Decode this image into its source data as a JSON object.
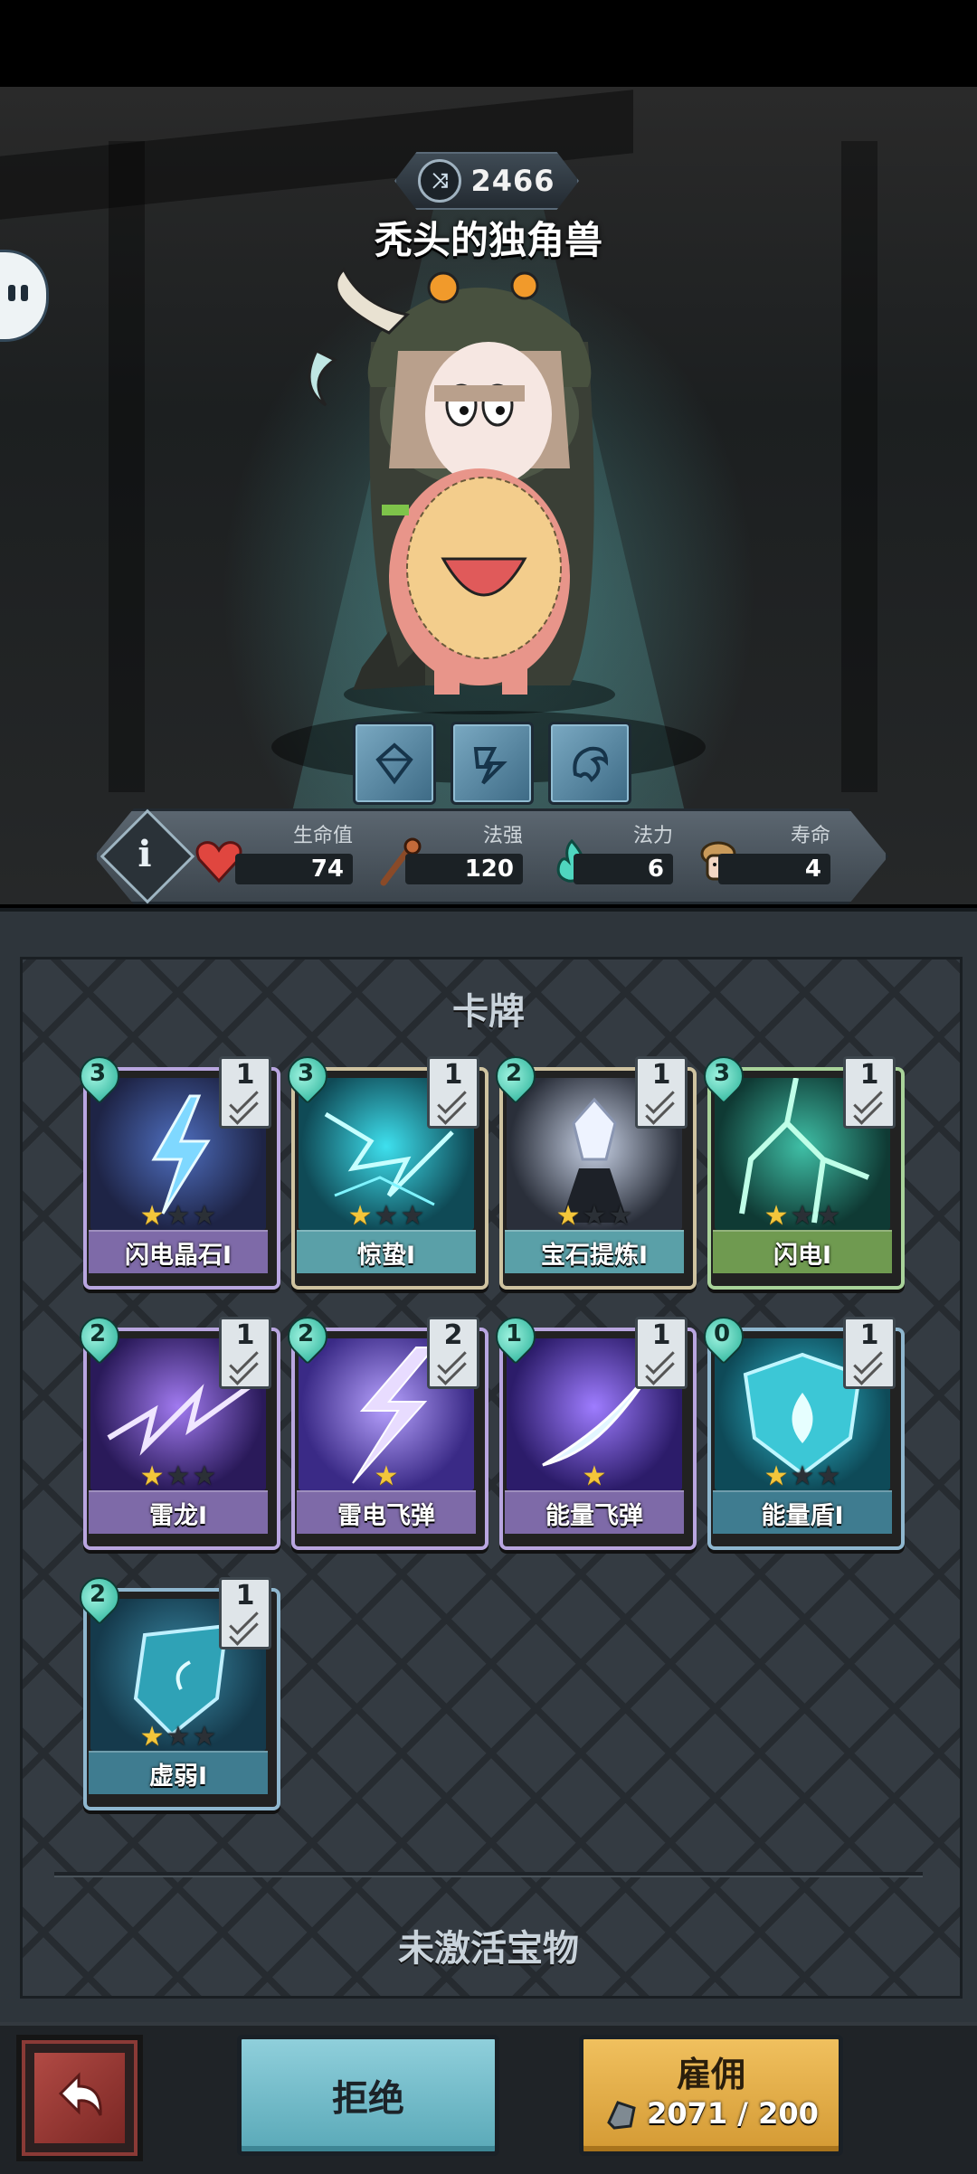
{
  "header": {
    "level": "2466",
    "character_name": "秃头的独角兽"
  },
  "stats": [
    {
      "label": "生命值",
      "value": "74",
      "icon": "heart-icon"
    },
    {
      "label": "法强",
      "value": "120",
      "icon": "staff-icon"
    },
    {
      "label": "法力",
      "value": "6",
      "icon": "mana-flame-icon"
    },
    {
      "label": "寿命",
      "value": "4",
      "icon": "lifespan-icon"
    }
  ],
  "skill_slots": [
    "gem-rune-icon",
    "lightning-rune-icon",
    "dragon-rune-icon"
  ],
  "cards_section": {
    "title": "卡牌",
    "cards": [
      {
        "name": "闪电晶石I",
        "cost": "3",
        "level": "1",
        "stars": 1,
        "total_stars": 3
      },
      {
        "name": "惊蛰I",
        "cost": "3",
        "level": "1",
        "stars": 1,
        "total_stars": 3
      },
      {
        "name": "宝石提炼I",
        "cost": "2",
        "level": "1",
        "stars": 1,
        "total_stars": 3
      },
      {
        "name": "闪电I",
        "cost": "3",
        "level": "1",
        "stars": 1,
        "total_stars": 3
      },
      {
        "name": "雷龙I",
        "cost": "2",
        "level": "1",
        "stars": 1,
        "total_stars": 3
      },
      {
        "name": "雷电飞弹",
        "cost": "2",
        "level": "2",
        "stars": 1,
        "total_stars": 1
      },
      {
        "name": "能量飞弹",
        "cost": "1",
        "level": "1",
        "stars": 1,
        "total_stars": 1
      },
      {
        "name": "能量盾I",
        "cost": "0",
        "level": "1",
        "stars": 1,
        "total_stars": 3
      },
      {
        "name": "虚弱I",
        "cost": "2",
        "level": "1",
        "stars": 1,
        "total_stars": 3
      }
    ]
  },
  "treasure_section": {
    "title": "未激活宝物"
  },
  "actions": {
    "back_icon": "return-arrow-icon",
    "reject_label": "拒绝",
    "hire_label": "雇佣",
    "hire_cost": "2071 / 200",
    "hire_cost_icon": "ore-icon"
  },
  "colors": {
    "purple_rim": "#b9a6e0",
    "green_rim": "#a9d39a",
    "blue_rim": "#8fb7cf",
    "beige_rim": "#cfc3a0",
    "star_on": "#f3c63b"
  }
}
